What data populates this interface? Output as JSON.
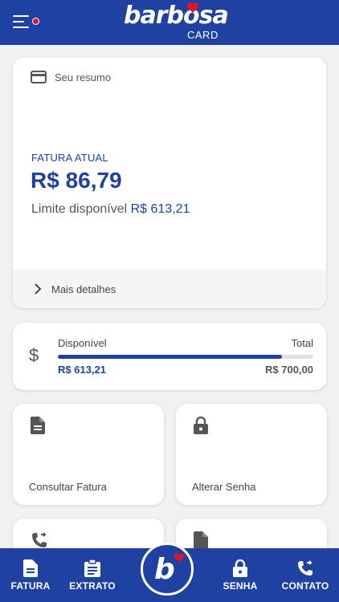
{
  "header": {
    "logo_text": "barbosa",
    "logo_sub": "CARD"
  },
  "summary": {
    "title": "Seu resumo",
    "fatura_label": "FATURA ATUAL",
    "fatura_value": "R$ 86,79",
    "limite_label": "Limite disponível",
    "limite_value": "R$ 613,21",
    "mais_detalhes": "Mais detalhes"
  },
  "availability": {
    "label_left": "Disponível",
    "label_right": "Total",
    "value_left": "R$ 613,21",
    "value_right": "R$ 700,00",
    "used_fraction": 0.876
  },
  "tiles": [
    {
      "label": "Consultar Fatura",
      "icon": "document-icon"
    },
    {
      "label": "Alterar Senha",
      "icon": "lock-icon"
    },
    {
      "label": "",
      "icon": "phone-forward-icon"
    },
    {
      "label": "",
      "icon": "document-icon"
    }
  ],
  "nav": {
    "fatura": "FATURA",
    "extrato": "EXTRATO",
    "senha": "SENHA",
    "contato": "CONTATO",
    "center_letter": "b"
  },
  "colors": {
    "brand_blue": "#1f41a2",
    "accent_red": "#e2142d",
    "background": "#f0f1f3"
  }
}
